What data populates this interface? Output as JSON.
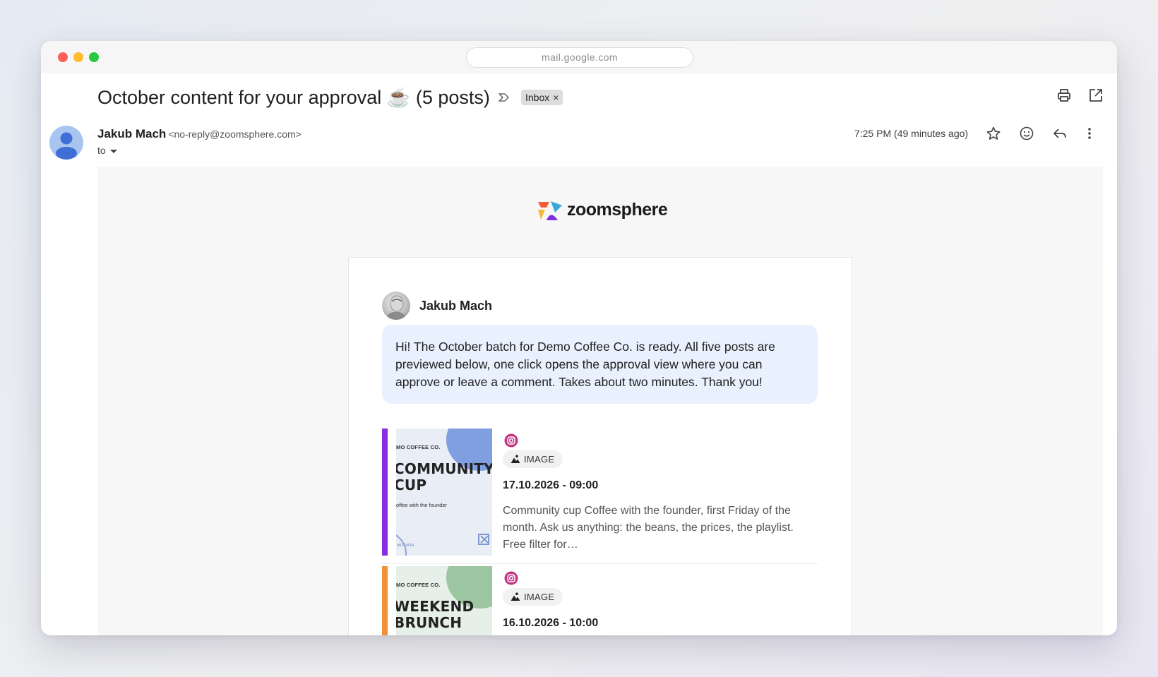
{
  "browser": {
    "url": "mail.google.com"
  },
  "email": {
    "subject": "October content for your approval ☕️ (5 posts)",
    "label": "Inbox",
    "label_remove": "×",
    "sender_name": "Jakub Mach",
    "sender_email": "<no-reply@zoomsphere.com>",
    "to_label": "to",
    "time": "7:25 PM (49 minutes ago)"
  },
  "body": {
    "brand": "zoomsphere",
    "author": "Jakub Mach",
    "message": "Hi! The October batch for Demo Coffee Co. is ready. All five posts are previewed below, one click opens the approval view where you can approve or leave a comment. Takes about two minutes. Thank you!",
    "posts": [
      {
        "bar_color": "#8a2be2",
        "thumb_bg": "#e9edf5",
        "thumb_accent": "#7f9fe0",
        "thumb_brand": "MO COFFEE CO.",
        "thumb_title_1": "COMMUNITY",
        "thumb_title_2": "CUP",
        "thumb_sub": "offee with the founder",
        "thumb_foot": "MO DATA",
        "type": "IMAGE",
        "date": "17.10.2026 - 09:00",
        "text": "Community cup Coffee with the founder, first Friday of the month. Ask us anything: the beans, the prices, the playlist. Free filter for…"
      },
      {
        "bar_color": "#f0913a",
        "thumb_bg": "#e6efe8",
        "thumb_accent": "#9cc5a1",
        "thumb_brand": "MO COFFEE CO.",
        "thumb_title_1": "WEEKEND",
        "thumb_title_2": "BRUNCH",
        "type": "IMAGE",
        "date": "16.10.2026 - 10:00"
      }
    ]
  },
  "colors": {
    "instagram": "#c13584",
    "message_bg": "#e8f1fd"
  }
}
